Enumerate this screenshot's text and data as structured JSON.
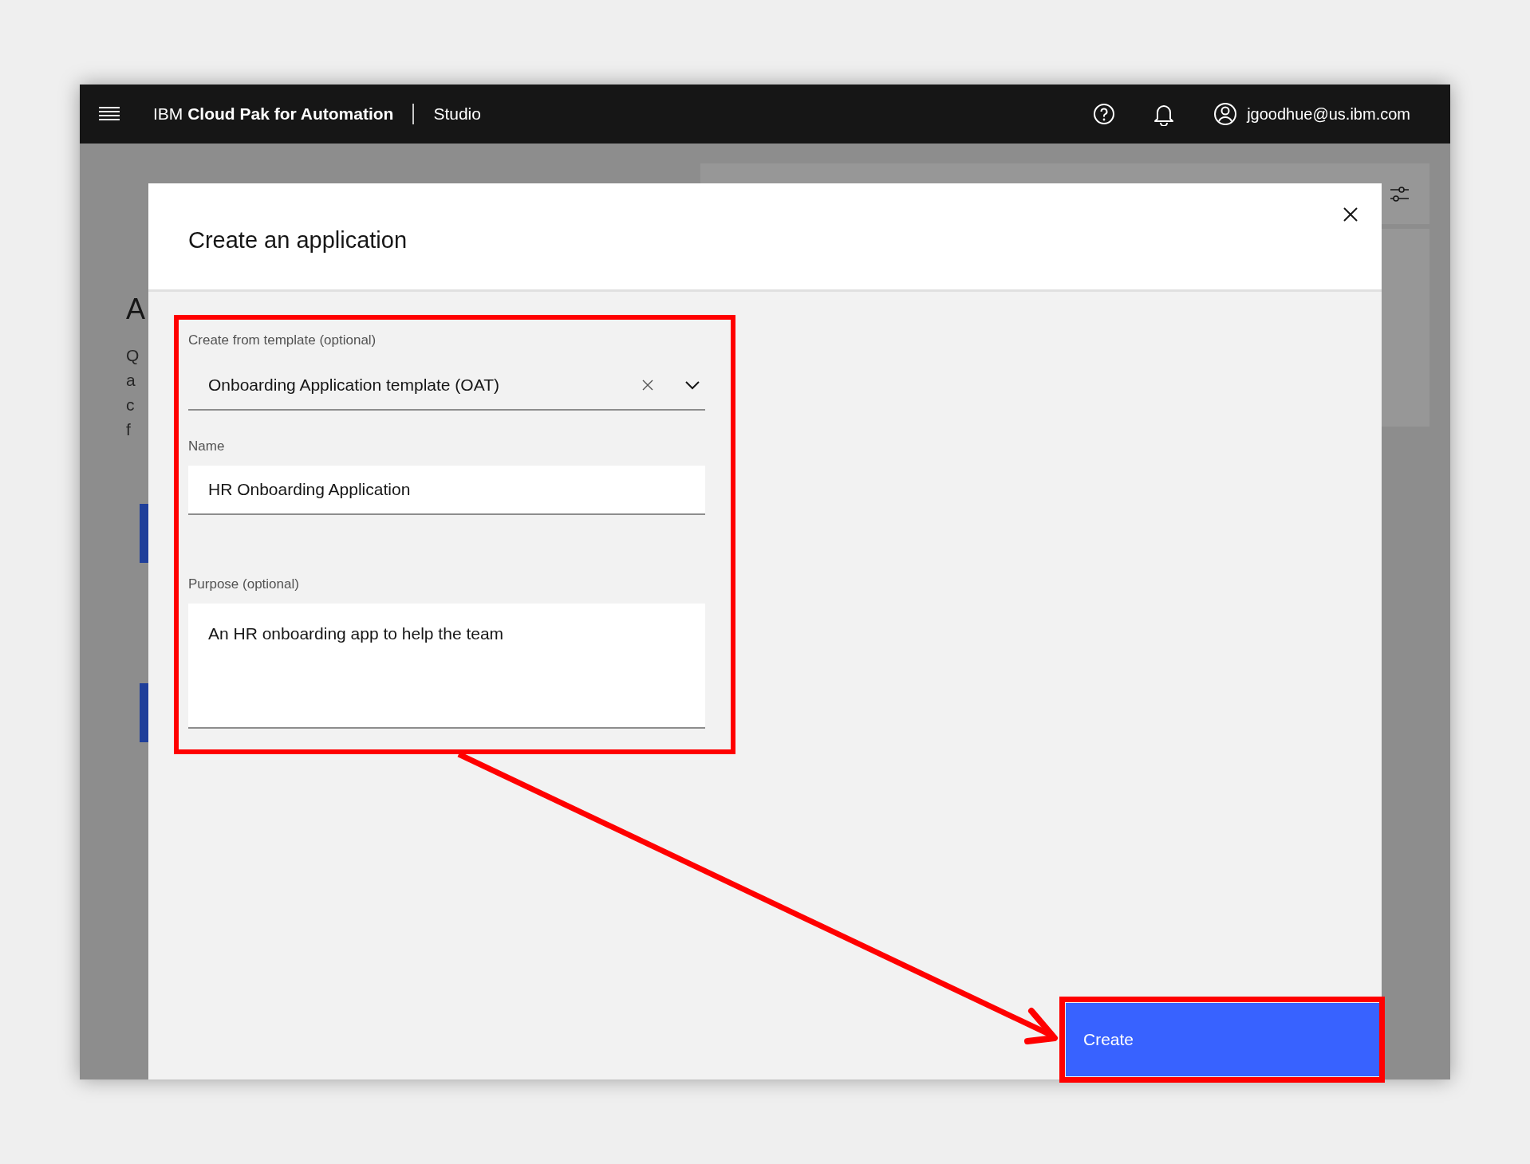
{
  "header": {
    "product_prefix": "IBM",
    "product_name": "Cloud Pak for Automation",
    "section": "Studio",
    "user": "jgoodhue@us.ibm.com"
  },
  "background": {
    "heading": "A",
    "paragraph_lines": [
      "Q",
      "a",
      "c",
      "f"
    ]
  },
  "dialog": {
    "title": "Create an application",
    "fields": [
      {
        "kind": "combobox",
        "label": "Create from template (optional)",
        "value": "Onboarding Application template (OAT)"
      },
      {
        "kind": "text",
        "label": "Name",
        "value": "HR Onboarding Application"
      },
      {
        "kind": "textarea",
        "label": "Purpose (optional)",
        "value": "An HR onboarding app to help the team"
      }
    ],
    "primary_button": "Create"
  }
}
